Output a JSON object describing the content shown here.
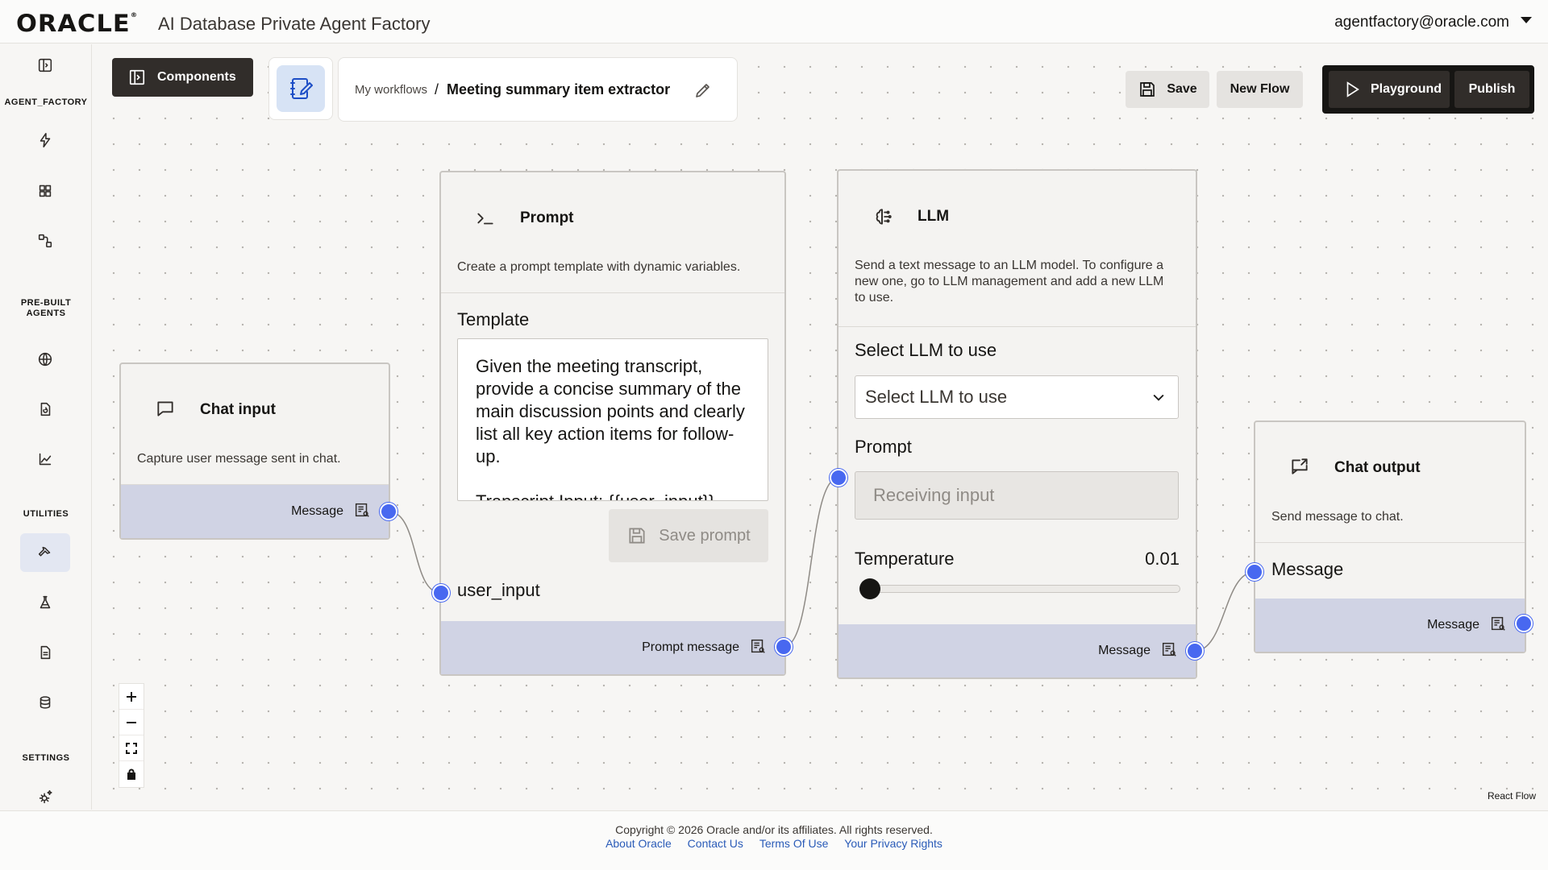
{
  "header": {
    "logo_text": "ORACLE",
    "logo_mark": "®",
    "app_title": "AI Database Private Agent Factory",
    "user_email": "agentfactory@oracle.com"
  },
  "sidebar": {
    "sections": {
      "agent_factory": "AGENT_FACTORY",
      "prebuilt_line1": "PRE-BUILT",
      "prebuilt_line2": "AGENTS",
      "utilities": "UTILITIES",
      "settings": "SETTINGS"
    }
  },
  "toolbar": {
    "components_label": "Components",
    "breadcrumb_root": "My workflows",
    "breadcrumb_sep": "/",
    "breadcrumb_title": "Meeting summary item extractor",
    "save_label": "Save",
    "new_flow_label": "New Flow",
    "playground_label": "Playground",
    "publish_label": "Publish"
  },
  "nodes": {
    "chat_input": {
      "title": "Chat input",
      "description": "Capture user message sent in chat.",
      "output_label": "Message"
    },
    "prompt": {
      "title": "Prompt",
      "description": "Create a prompt template with dynamic variables.",
      "template_label": "Template",
      "template_text": "Given the meeting transcript, provide a concise summary of the main discussion points and clearly list all key action items for follow-up.",
      "template_text_2": "Transcript Input: {{user_input}}",
      "save_prompt_label": "Save prompt",
      "variable_label": "user_input",
      "output_label": "Prompt message"
    },
    "llm": {
      "title": "LLM",
      "description": "Send a text message to an LLM model. To configure a new one, go to LLM management and add a new LLM to use.",
      "select_label": "Select LLM to use",
      "select_value": "Select LLM to use",
      "prompt_label": "Prompt",
      "prompt_placeholder": "Receiving input",
      "temperature_label": "Temperature",
      "temperature_value": "0.01",
      "output_label": "Message"
    },
    "chat_output": {
      "title": "Chat output",
      "description": "Send message to chat.",
      "input_label": "Message",
      "output_label": "Message"
    }
  },
  "canvas": {
    "attribution": "React Flow"
  },
  "footer": {
    "copyright": "Copyright © 2026 Oracle and/or its affiliates. All rights reserved.",
    "links": [
      "About Oracle",
      "Contact Us",
      "Terms Of Use",
      "Your Privacy Rights"
    ]
  },
  "colors": {
    "accent": "#4868f0",
    "dark": "#312d2a",
    "node_footer": "#d0d3e4",
    "link": "#2a5bb8"
  }
}
